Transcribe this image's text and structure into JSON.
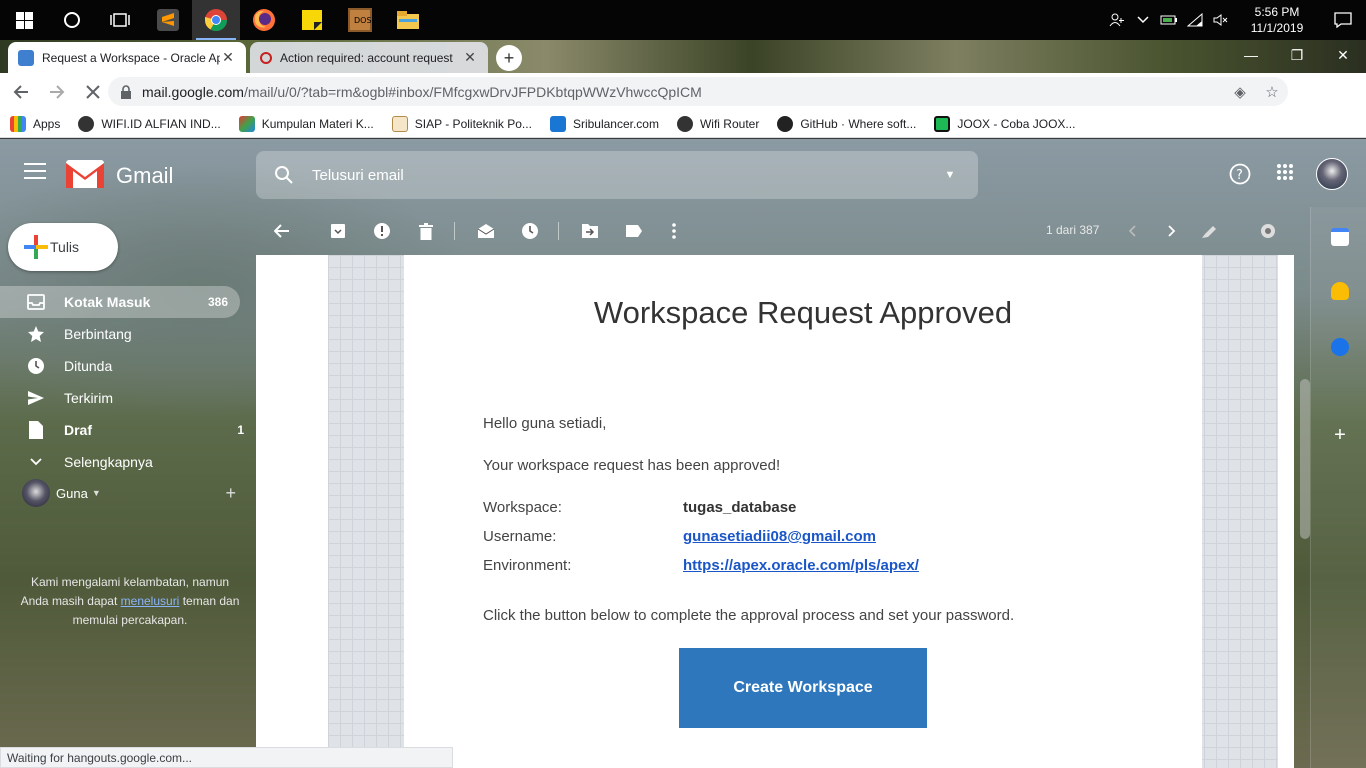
{
  "taskbar": {
    "time": "5:56 PM",
    "date": "11/1/2019"
  },
  "browser": {
    "tabs": [
      {
        "title": "Request a Workspace - Oracle Ap"
      },
      {
        "title": "Action required: account request"
      }
    ],
    "url_host": "mail.google.com",
    "url_path": "/mail/u/0/?tab=rm&ogbl#inbox/FMfcgxwDrvJFPDKbtqpWWzVhwccQpICM",
    "bookmarks": [
      "Apps",
      "WIFI.ID ALFIAN IND...",
      "Kumpulan Materi K...",
      "SIAP - Politeknik Po...",
      "Sribulancer.com",
      "Wifi Router",
      "GitHub · Where soft...",
      "JOOX - Coba JOOX..."
    ],
    "status_text": "Waiting for hangouts.google.com..."
  },
  "gmail": {
    "brand": "Gmail",
    "search_placeholder": "Telusuri email",
    "compose_label": "Tulis",
    "nav": [
      {
        "label": "Kotak Masuk",
        "count": "386"
      },
      {
        "label": "Berbintang",
        "count": ""
      },
      {
        "label": "Ditunda",
        "count": ""
      },
      {
        "label": "Terkirim",
        "count": ""
      },
      {
        "label": "Draf",
        "count": "1"
      },
      {
        "label": "Selengkapnya",
        "count": ""
      }
    ],
    "hangouts_user": "Guna",
    "hangouts_msg_pre": "Kami mengalami kelambatan, namun Anda masih dapat ",
    "hangouts_msg_link": "menelusuri",
    "hangouts_msg_post": " teman dan memulai percakapan.",
    "pager": "1 dari 387"
  },
  "email": {
    "title": "Workspace Request Approved",
    "greeting": "Hello guna setiadi,",
    "approved_line": "Your workspace request has been approved!",
    "workspace_label": "Workspace:",
    "workspace_value": "tugas_database",
    "username_label": "Username:",
    "username_value": "gunasetiadii08@gmail.com",
    "environment_label": "Environment:",
    "environment_value": "https://apex.oracle.com/pls/apex/",
    "instruction": "Click the button below to complete the approval process and set your password.",
    "cta_label": "Create Workspace"
  },
  "colors": {
    "cta_blue": "#2f77bc",
    "link_blue": "#1a56c7",
    "gmail_red": "#ea4335"
  }
}
